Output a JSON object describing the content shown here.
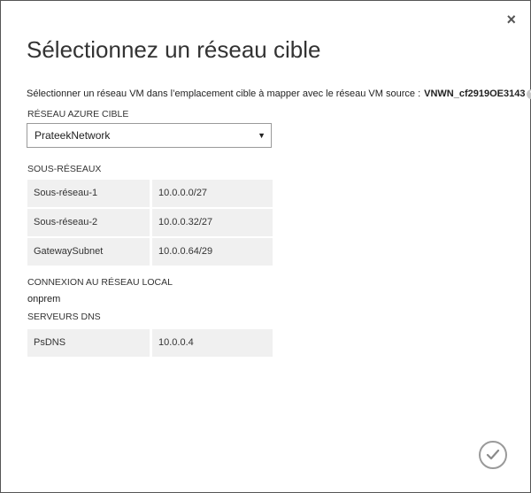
{
  "dialog": {
    "title": "Sélectionnez un réseau cible",
    "close_glyph": "×",
    "intro_text": "Sélectionner un réseau VM dans l’emplacement cible à mapper avec le réseau VM source :",
    "source_vm_network": "VNWN_cf2919OE3143",
    "help_glyph": "?"
  },
  "azure_network": {
    "label": "RÉSEAU AZURE CIBLE",
    "selected": "PrateekNetwork",
    "arrow": "▼"
  },
  "subnets": {
    "label": "SOUS-RÉSEAUX",
    "rows": [
      {
        "name": "Sous-réseau-1",
        "value": "10.0.0.0/27"
      },
      {
        "name": "Sous-réseau-2",
        "value": "10.0.0.32/27"
      },
      {
        "name": "GatewaySubnet",
        "value": "10.0.0.64/29"
      }
    ]
  },
  "local_network": {
    "label": "CONNEXION AU RÉSEAU LOCAL",
    "value": "onprem"
  },
  "dns": {
    "label": "SERVEURS DNS",
    "rows": [
      {
        "name": "PsDNS",
        "value": "10.0.0.4"
      }
    ]
  },
  "icons": {
    "close": "close-icon",
    "confirm": "checkmark-icon",
    "help": "help-icon",
    "dropdown": "chevron-down-icon"
  },
  "colors": {
    "border": "#555555",
    "cell_bg": "#f0f0f0",
    "confirm_ring": "#9a9a9a"
  }
}
